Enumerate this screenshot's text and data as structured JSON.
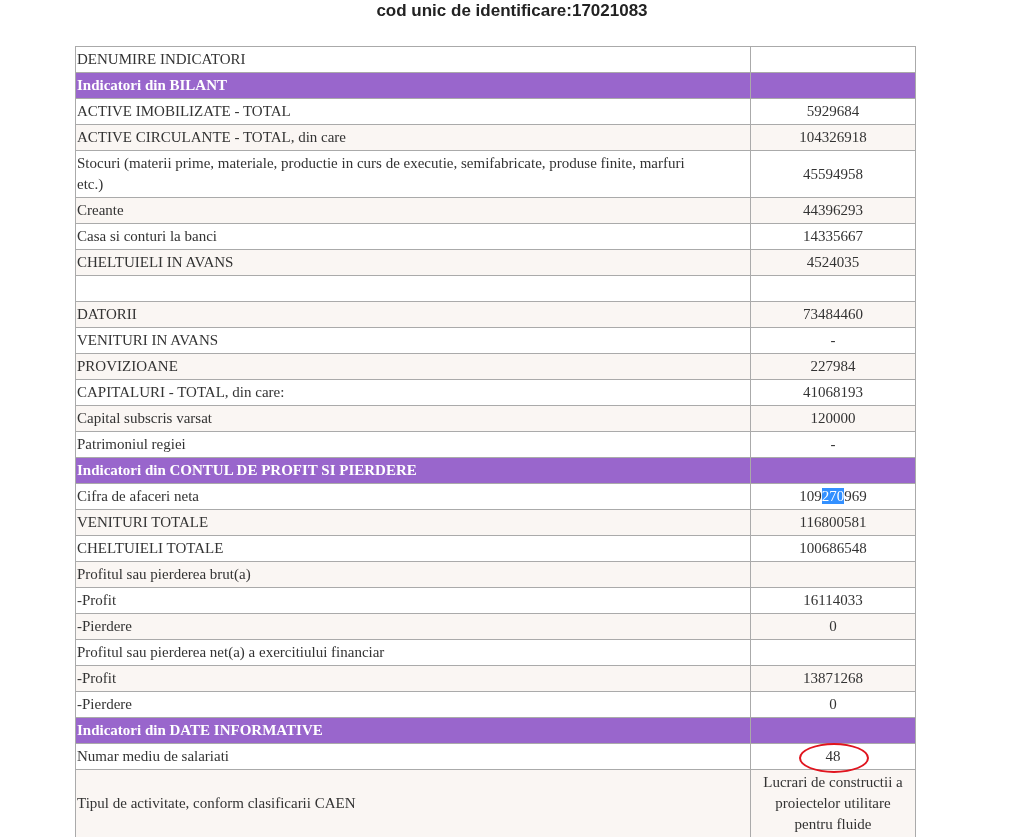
{
  "title": "cod unic de identificare:17021083",
  "rows": [
    {
      "kind": "row",
      "label": "DENUMIRE INDICATORI",
      "value": ""
    },
    {
      "kind": "section",
      "label": "Indicatori din BILANT"
    },
    {
      "kind": "row",
      "label": "ACTIVE IMOBILIZATE - TOTAL",
      "value": "5929684"
    },
    {
      "kind": "row",
      "label": "ACTIVE CIRCULANTE - TOTAL, din care",
      "value": "104326918"
    },
    {
      "kind": "row",
      "label": "Stocuri (materii prime, materiale, productie in curs de executie, semifabricate, produse finite, marfuri etc.)",
      "value": "45594958"
    },
    {
      "kind": "row",
      "label": "Creante",
      "value": "44396293"
    },
    {
      "kind": "row",
      "label": "Casa si conturi la banci",
      "value": "14335667"
    },
    {
      "kind": "row",
      "label": "CHELTUIELI IN AVANS",
      "value": "4524035"
    },
    {
      "kind": "row",
      "label": "",
      "value": ""
    },
    {
      "kind": "row",
      "label": "DATORII",
      "value": "73484460"
    },
    {
      "kind": "row",
      "label": "VENITURI IN AVANS",
      "value": "-"
    },
    {
      "kind": "row",
      "label": "PROVIZIOANE",
      "value": "227984"
    },
    {
      "kind": "row",
      "label": "CAPITALURI - TOTAL, din care:",
      "value": "41068193"
    },
    {
      "kind": "row",
      "label": "Capital subscris varsat",
      "value": "120000"
    },
    {
      "kind": "row",
      "label": "Patrimoniul regiei",
      "value": "-"
    },
    {
      "kind": "section",
      "label": "Indicatori din CONTUL DE PROFIT SI PIERDERE"
    },
    {
      "kind": "row",
      "label": "Cifra de afaceri neta",
      "value_parts": [
        {
          "text": "109",
          "selected": false
        },
        {
          "text": "270",
          "selected": true
        },
        {
          "text": "969",
          "selected": false
        }
      ]
    },
    {
      "kind": "row",
      "label": "VENITURI TOTALE",
      "value": "116800581"
    },
    {
      "kind": "row",
      "label": "CHELTUIELI TOTALE",
      "value": "100686548"
    },
    {
      "kind": "row",
      "label": "Profitul sau pierderea brut(a)",
      "value": ""
    },
    {
      "kind": "row",
      "label": "-Profit",
      "value": "16114033"
    },
    {
      "kind": "row",
      "label": "-Pierdere",
      "value": "0"
    },
    {
      "kind": "row",
      "label": "Profitul sau pierderea net(a) a exercitiului financiar",
      "value": ""
    },
    {
      "kind": "row",
      "label": "-Profit",
      "value": "13871268"
    },
    {
      "kind": "row",
      "label": "-Pierdere",
      "value": "0"
    },
    {
      "kind": "section",
      "label": "Indicatori din DATE INFORMATIVE"
    },
    {
      "kind": "row",
      "label": "Numar mediu de salariati",
      "value": "48",
      "circled": true
    },
    {
      "kind": "row",
      "label": "Tipul de activitate, conform clasificarii CAEN",
      "value": "Lucrari de constructii a proiectelor utilitare pentru fluide"
    }
  ]
}
